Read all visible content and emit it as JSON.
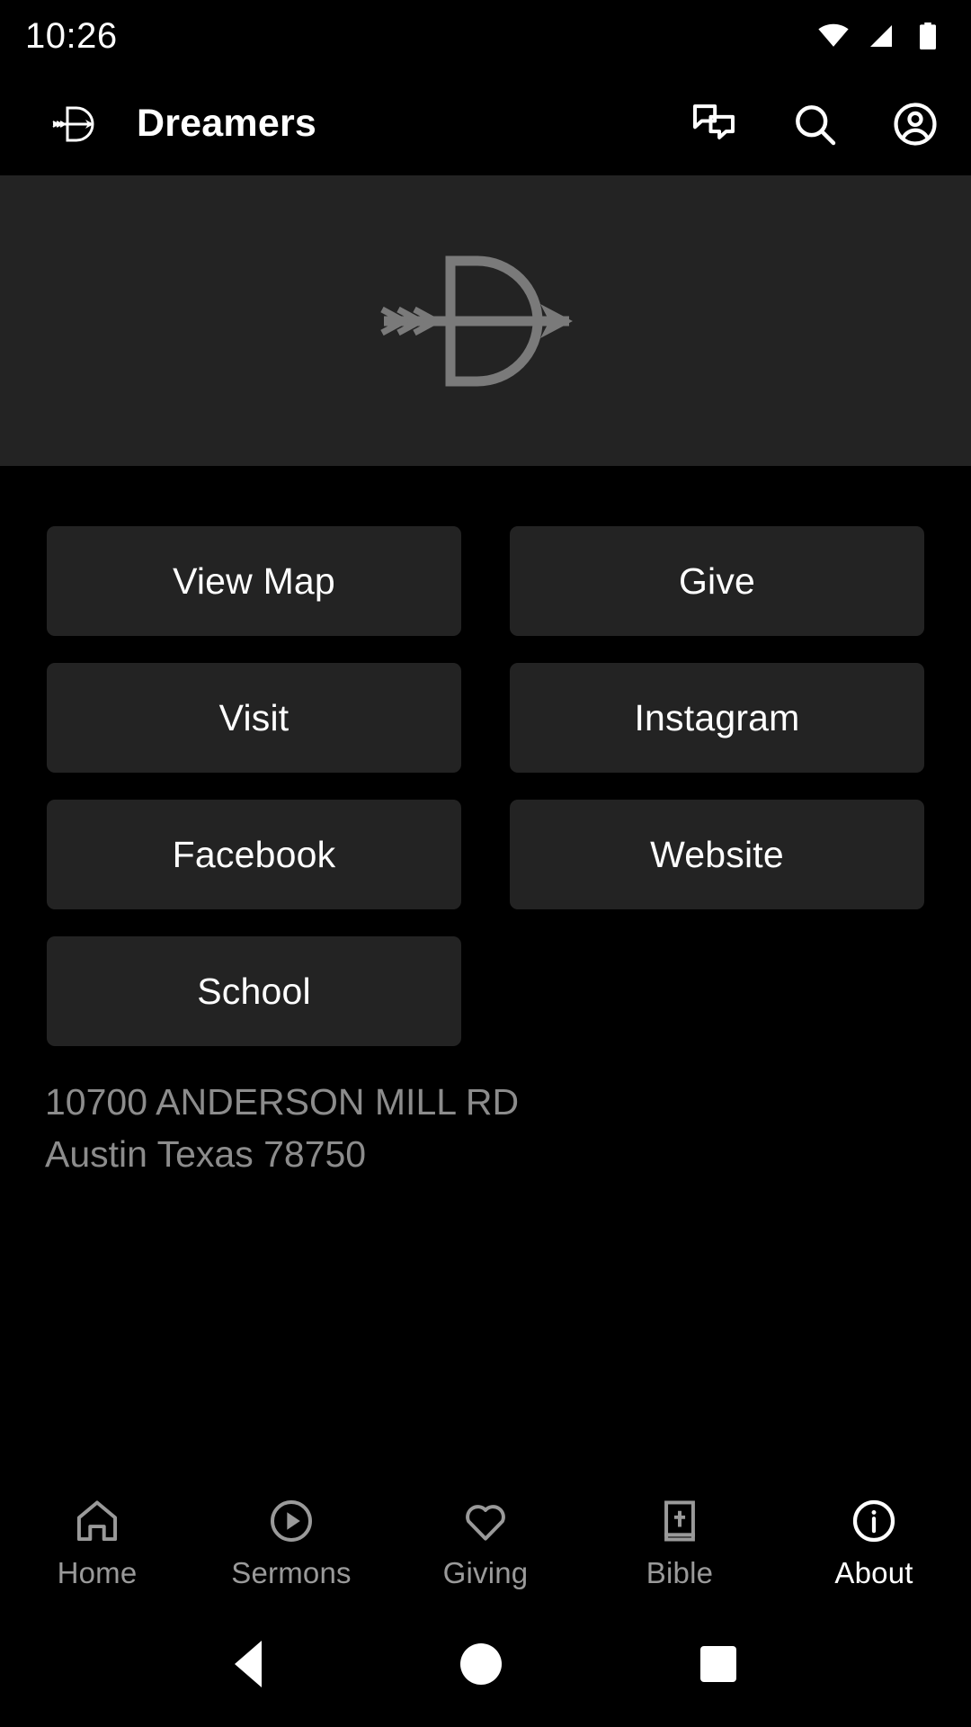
{
  "status_bar": {
    "time": "10:26",
    "icons": [
      "wifi-icon",
      "cellular-signal-icon",
      "battery-icon"
    ]
  },
  "header": {
    "logo_icon": "dreamers-arrow-logo-icon",
    "title": "Dreamers",
    "actions": [
      {
        "name": "chat-bubbles-icon",
        "label": "Chat"
      },
      {
        "name": "search-icon",
        "label": "Search"
      },
      {
        "name": "account-circle-icon",
        "label": "Account"
      }
    ]
  },
  "hero": {
    "logo_icon": "dreamers-arrow-logo-large-icon",
    "background_color": "#232323",
    "logo_color": "#7a7a7a"
  },
  "buttons": [
    {
      "label": "View Map"
    },
    {
      "label": "Give"
    },
    {
      "label": "Visit"
    },
    {
      "label": "Instagram"
    },
    {
      "label": "Facebook"
    },
    {
      "label": "Website"
    },
    {
      "label": "School"
    }
  ],
  "address": {
    "line1": "10700 ANDERSON MILL RD",
    "line2": "Austin Texas 78750"
  },
  "bottom_nav": {
    "items": [
      {
        "label": "Home",
        "icon": "home-icon",
        "active": false
      },
      {
        "label": "Sermons",
        "icon": "play-circle-icon",
        "active": false
      },
      {
        "label": "Giving",
        "icon": "heart-icon",
        "active": false
      },
      {
        "label": "Bible",
        "icon": "bible-book-icon",
        "active": false
      },
      {
        "label": "About",
        "icon": "info-circle-icon",
        "active": true
      }
    ]
  },
  "system_nav": {
    "back": "back-triangle-icon",
    "home": "home-circle-icon",
    "recents": "recents-square-icon"
  },
  "theme": {
    "background": "#000000",
    "surface": "#232323",
    "text_primary": "#ffffff",
    "text_muted": "#8c8c8c"
  }
}
